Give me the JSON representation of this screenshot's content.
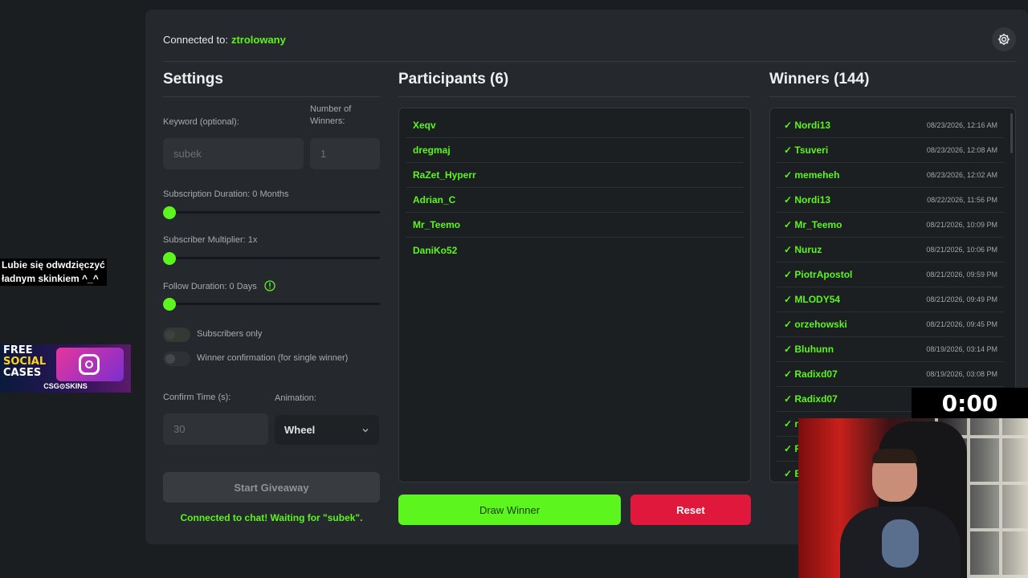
{
  "overlay": {
    "caption_line1": "Lubie się odwdzięczyć",
    "caption_line2": "ładnym skinkiem ^_^",
    "ad_title_1": "FREE",
    "ad_title_2": "SOCIAL",
    "ad_title_3": "CASES",
    "ad_footer": "CSG⊙SKINS",
    "timer": "0:00"
  },
  "header": {
    "connected_label": "Connected to:",
    "channel": "ztrolowany"
  },
  "settings": {
    "title": "Settings",
    "keyword_label": "Keyword (optional):",
    "keyword_value": "subek",
    "winners_label_1": "Number of",
    "winners_label_2": "Winners:",
    "winners_value": "1",
    "sub_duration_label": "Subscription Duration: 0 Months",
    "sub_multiplier_label": "Subscriber Multiplier: 1x",
    "follow_duration_label": "Follow Duration:  0  Days",
    "subscribers_only_label": "Subscribers only",
    "winner_confirmation_label": "Winner confirmation (for single winner)",
    "confirm_time_label": "Confirm Time (s):",
    "confirm_time_value": "30",
    "animation_label": "Animation:",
    "animation_value": "Wheel",
    "start_label": "Start Giveaway",
    "status": "Connected to chat! Waiting for \"subek\"."
  },
  "participants": {
    "title": "Participants (6)",
    "items": [
      "Xeqv",
      "dregmaj",
      "RaZet_Hyperr",
      "Adrian_C",
      "Mr_Teemo",
      "DaniKo52"
    ]
  },
  "winners": {
    "title": "Winners (144)",
    "items": [
      {
        "name": "✓ Nordi13",
        "date": "08/23/2026, 12:16 AM"
      },
      {
        "name": "✓ Tsuveri",
        "date": "08/23/2026, 12:08 AM"
      },
      {
        "name": "✓ memeheh",
        "date": "08/23/2026, 12:02 AM"
      },
      {
        "name": "✓ Nordi13",
        "date": "08/22/2026, 11:56 PM"
      },
      {
        "name": "✓ Mr_Teemo",
        "date": "08/21/2026, 10:09 PM"
      },
      {
        "name": "✓ Nuruz",
        "date": "08/21/2026, 10:06 PM"
      },
      {
        "name": "✓ PiotrApostol",
        "date": "08/21/2026, 09:59 PM"
      },
      {
        "name": "✓ MLODY54",
        "date": "08/21/2026, 09:49 PM"
      },
      {
        "name": "✓ orzehowski",
        "date": "08/21/2026, 09:45 PM"
      },
      {
        "name": "✓ Bluhunn",
        "date": "08/19/2026, 03:14 PM"
      },
      {
        "name": "✓ Radixd07",
        "date": "08/19/2026, 03:08 PM"
      },
      {
        "name": "✓ Radixd07",
        "date": ""
      },
      {
        "name": "✓ n",
        "date": ""
      },
      {
        "name": "✓ R",
        "date": ""
      },
      {
        "name": "✓ B",
        "date": ""
      }
    ]
  },
  "actions": {
    "draw_label": "Draw Winner",
    "reset_label": "Reset"
  },
  "colors": {
    "accent": "#5cf51e",
    "danger": "#e0193c",
    "panel": "#25282c"
  }
}
